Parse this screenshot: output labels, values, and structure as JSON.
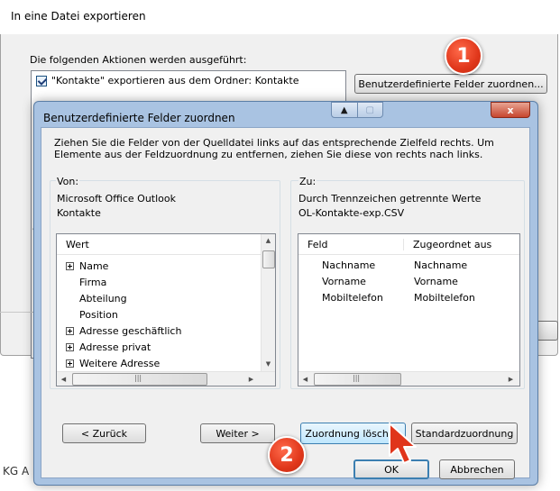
{
  "background_dialog": {
    "title": "In eine Datei exportieren",
    "section_label": "Die folgenden Aktionen werden ausgeführt:",
    "action_item": "\"Kontakte\" exportieren aus dem Ordner: Kontakte",
    "map_fields_button": "Benutzerdefinierte Felder zuordnen...",
    "cut_text_1": "D",
    "cut_text_2": "a",
    "partial_bottom_text": "KG A"
  },
  "dialog": {
    "title": "Benutzerdefinierte Felder zuordnen",
    "close_label": "x",
    "instruction": "Ziehen Sie die Felder von der Quelldatei links auf das entsprechende Zielfeld rechts. Um Elemente aus der Feldzuordnung zu entfernen, ziehen Sie diese von rechts nach links.",
    "source": {
      "label": "Von:",
      "application": "Microsoft Office Outlook",
      "folder": "Kontakte",
      "column_header": "Wert",
      "items": [
        {
          "label": "Name",
          "expandable": true
        },
        {
          "label": "Firma",
          "expandable": false
        },
        {
          "label": "Abteilung",
          "expandable": false
        },
        {
          "label": "Position",
          "expandable": false
        },
        {
          "label": "Adresse geschäftlich",
          "expandable": true
        },
        {
          "label": "Adresse privat",
          "expandable": true
        },
        {
          "label": "Weitere Adresse",
          "expandable": true
        }
      ]
    },
    "target": {
      "label": "Zu:",
      "type": "Durch Trennzeichen getrennte Werte",
      "file": "OL-Kontakte-exp.CSV",
      "columns": [
        "Feld",
        "Zugeordnet aus"
      ],
      "rows": [
        [
          "Nachname",
          "Nachname"
        ],
        [
          "Vorname",
          "Vorname"
        ],
        [
          "Mobiltelefon",
          "Mobiltelefon"
        ]
      ]
    },
    "buttons": {
      "back": "< Zurück",
      "next": "Weiter >",
      "clear_map": "Zuordnung löschen",
      "default_map": "Standardzuordnung",
      "ok": "OK",
      "cancel": "Abbrechen"
    }
  },
  "annotations": {
    "badge_1": "1",
    "badge_2": "2"
  }
}
